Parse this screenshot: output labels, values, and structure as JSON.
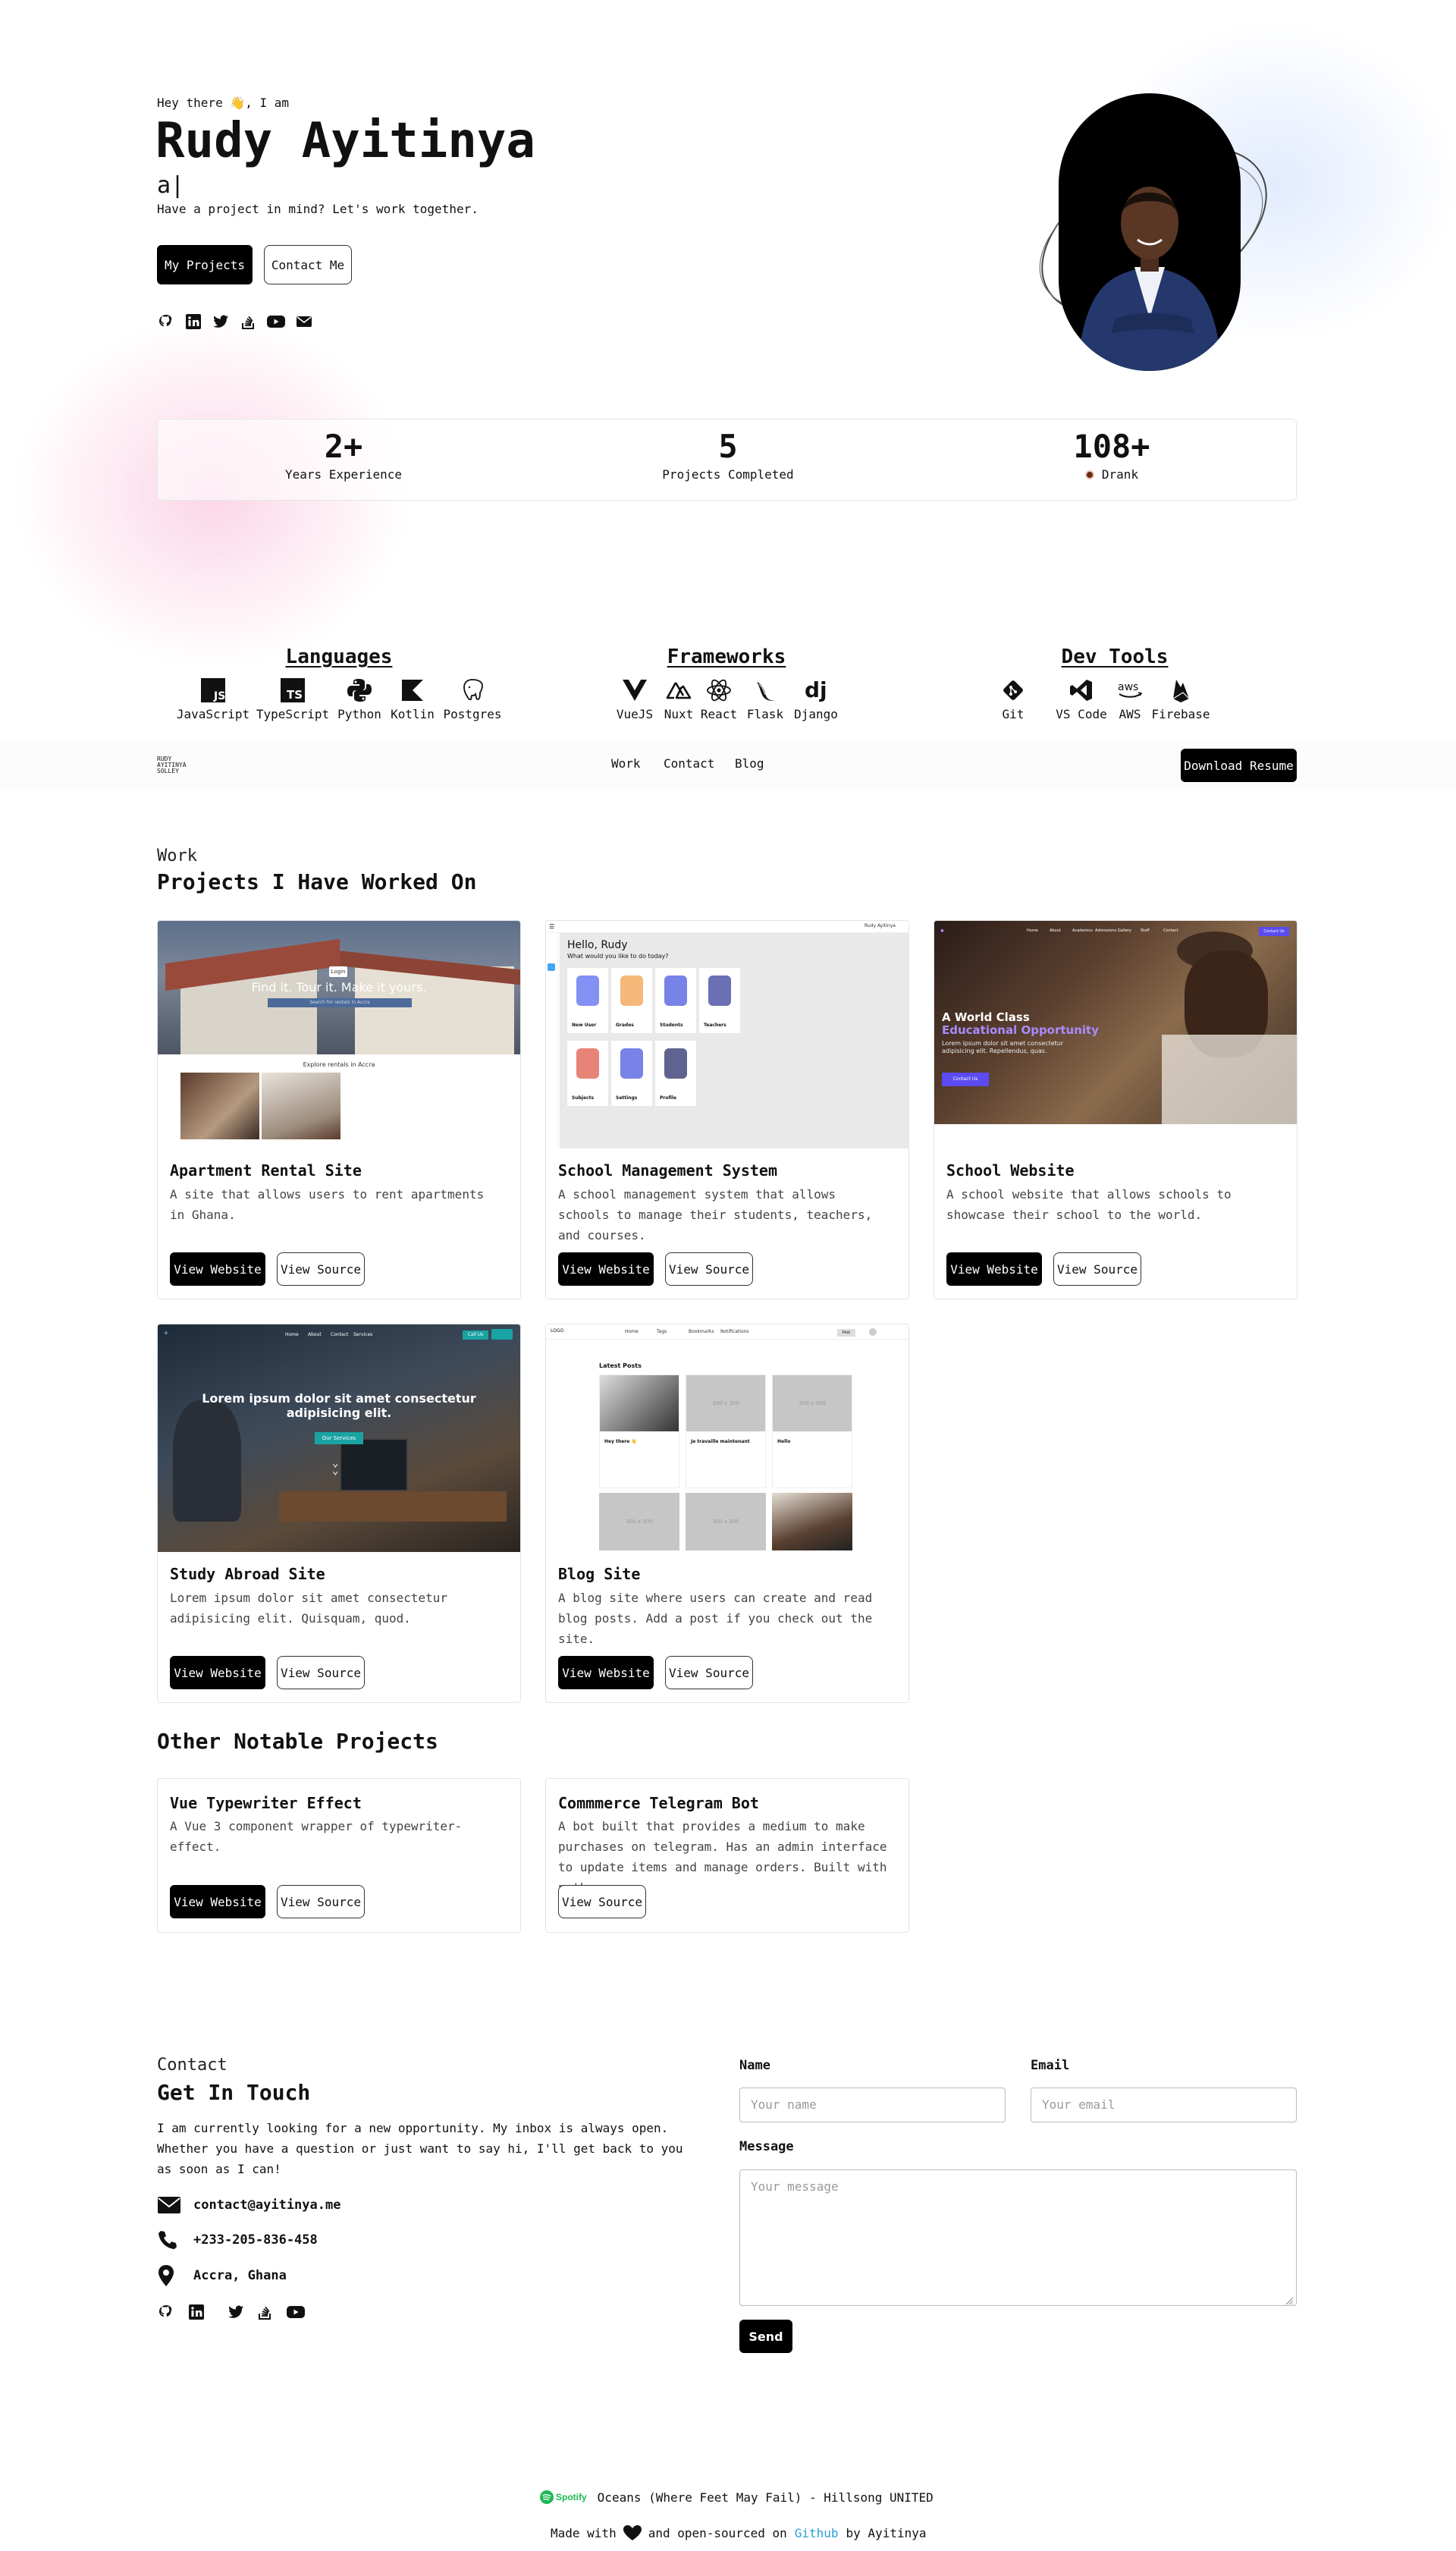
{
  "hero": {
    "greeting": "Hey there 👋, I am",
    "name": "Rudy Ayitinya",
    "typed": "a|",
    "tagline": "Have a project in mind? Let's work together.",
    "btn_projects": "My Projects",
    "btn_contact": "Contact Me",
    "socials": [
      "github-icon",
      "linkedin-icon",
      "twitter-icon",
      "stackoverflow-icon",
      "youtube-icon",
      "email-icon"
    ]
  },
  "stats": [
    {
      "num": "2+",
      "label": "Years Experience"
    },
    {
      "num": "5",
      "label": "Projects Completed"
    },
    {
      "num": "108+",
      "label": "Drank",
      "icon": "coffee-icon"
    }
  ],
  "skills": {
    "languages": {
      "title": "Languages",
      "items": [
        "JavaScript",
        "TypeScript",
        "Python",
        "Kotlin",
        "Postgres"
      ]
    },
    "frameworks": {
      "title": "Frameworks",
      "items": [
        "VueJS",
        "Nuxt",
        "React",
        "Flask",
        "Django"
      ]
    },
    "devtools": {
      "title": "Dev Tools",
      "items": [
        "Git",
        "VS Code",
        "AWS",
        "Firebase"
      ]
    }
  },
  "nav": {
    "logo": "RUDY AYITINYA SOLLEY",
    "links": [
      "Work",
      "Contact",
      "Blog"
    ],
    "resume": "Download Resume"
  },
  "work": {
    "kicker": "Work",
    "title": "Projects I Have Worked On",
    "projects": [
      {
        "title": "Apartment Rental Site",
        "desc": "A site that allows users to rent apartments in Ghana.",
        "view": "View Website",
        "source": "View Source",
        "shot": {
          "login": "Login",
          "headline": "Find it. Tour it. Make it yours.",
          "search": "Search for rentals in Accra",
          "explore": "Explore rentals in Accra"
        }
      },
      {
        "title": "School Management System",
        "desc": "A school management system that allows schools to manage their students, teachers, and courses.",
        "view": "View Website",
        "source": "View Source",
        "shot": {
          "hello": "Hello, Rudy",
          "sub": "What would you like to do today?",
          "user": "Rudy Ayitinya",
          "tiles": [
            "New User",
            "Grades",
            "Students",
            "Teachers",
            "Subjects",
            "Settings",
            "Profile"
          ]
        }
      },
      {
        "title": "School Website",
        "desc": "A school website that allows schools to showcase their school to the world.",
        "view": "View Website",
        "source": "View Source",
        "shot": {
          "nav": [
            "Home",
            "About",
            "Academics",
            "Admissions",
            "Gallery",
            "Staff",
            "Contact"
          ],
          "cta_nav": "Contact Us",
          "h1": "A World Class",
          "h2": "Educational Opportunity",
          "p": "Lorem ipsum dolor sit amet consectetur adipisicing elit. Repellendus, quas.",
          "btn": "Contact Us"
        }
      },
      {
        "title": "Study Abroad Site",
        "desc": "Lorem ipsum dolor sit amet consectetur adipisicing elit. Quisquam, quod.",
        "view": "View Website",
        "source": "View Source",
        "shot": {
          "nav": [
            "Home",
            "About",
            "Contact",
            "Services"
          ],
          "call": "Call Us",
          "headline": "Lorem ipsum dolor sit amet consectetur adipisicing elit.",
          "btn": "Our Services"
        }
      },
      {
        "title": "Blog Site",
        "desc": "A blog site where users can create and read blog posts. Add a post if you check out the site.",
        "view": "View Website",
        "source": "View Source",
        "shot": {
          "logo": "LOGO",
          "nav": [
            "Home",
            "Tags",
            "Bookmarks",
            "Notifications"
          ],
          "post_btn": "Post",
          "section": "Latest Posts",
          "ph": "300 x 300",
          "posts": [
            "Hey there 👋",
            "Je travaille maintenant",
            "Hello"
          ]
        }
      }
    ]
  },
  "other": {
    "title": "Other Notable Projects",
    "projects": [
      {
        "title": "Vue Typewriter Effect",
        "desc": "A Vue 3 component wrapper of typewriter-effect.",
        "view": "View Website",
        "source": "View Source"
      },
      {
        "title": "Commmerce Telegram Bot",
        "desc": "A bot built that provides a medium to make purchases on telegram. Has an admin interface to update items and manage orders. Built with python",
        "source": "View Source"
      }
    ]
  },
  "contact": {
    "kicker": "Contact",
    "title": "Get In Touch",
    "text": "I am currently looking for a new opportunity. My inbox is always open. Whether you have a question or just want to say hi, I'll get back to you as soon as I can!",
    "email": "contact@ayitinya.me",
    "phone": "+233-205-836-458",
    "location": "Accra, Ghana",
    "form": {
      "name_label": "Name",
      "name_placeholder": "Your name",
      "email_label": "Email",
      "email_placeholder": "Your email",
      "message_label": "Message",
      "message_placeholder": "Your message",
      "send": "Send"
    }
  },
  "footer": {
    "spotify": "Spotify",
    "now_playing": "Oceans (Where Feet May Fail) - Hillsong UNITED",
    "made_with": "Made with",
    "and": "and open-sourced on",
    "github": "Github",
    "by": "by Ayitinya"
  },
  "colors": {
    "accent_dark": "#000000",
    "spotify_green": "#1DB954",
    "link_blue": "#2a9fd6",
    "school_purple": "#5b4bf0"
  }
}
